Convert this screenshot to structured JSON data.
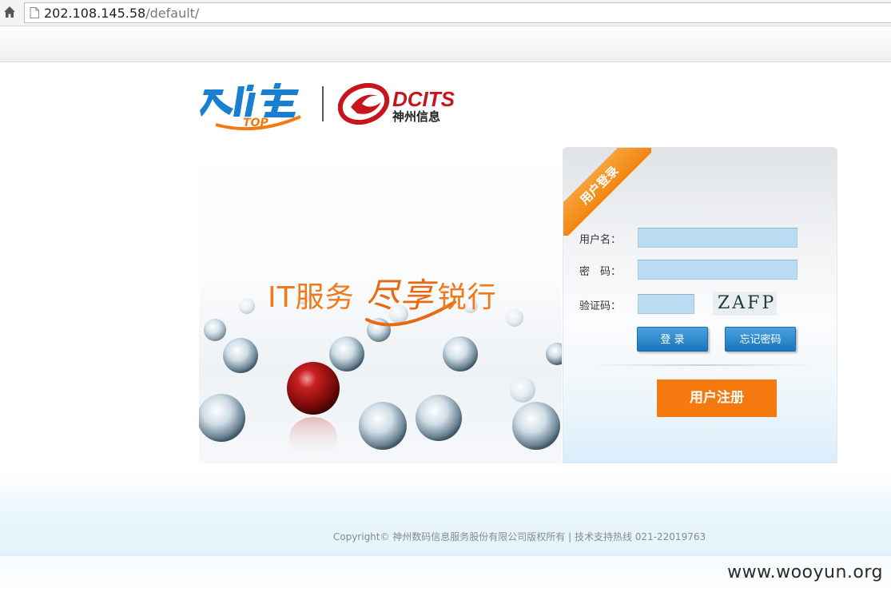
{
  "browser": {
    "url_host": "202.108.145.58",
    "url_path": "/default/"
  },
  "brand": {
    "logo_left_text": "TOP",
    "logo_right_en": "DCITS",
    "logo_right_cn": "神州信息"
  },
  "banner": {
    "slogan_part1": "IT服务",
    "slogan_script": "尽享",
    "slogan_part2": "锐行"
  },
  "login": {
    "ribbon_label": "用户登录",
    "username_label": "用户名：",
    "password_label": "密　码：",
    "captcha_label": "验证码：",
    "captcha_text": "ZAFP",
    "username_value": "",
    "password_value": "",
    "captcha_value": "",
    "login_button": "登 录",
    "forgot_button": "忘记密码",
    "register_button": "用户注册"
  },
  "footer": {
    "copyright": "Copyright© 神州数码信息服务股份有限公司版权所有 | 技术支持热线 021-22019763",
    "watermark": "www.wooyun.org"
  },
  "colors": {
    "accent_orange": "#f47a10",
    "button_blue": "#1b74bd",
    "input_blue": "#b9dcf2"
  }
}
